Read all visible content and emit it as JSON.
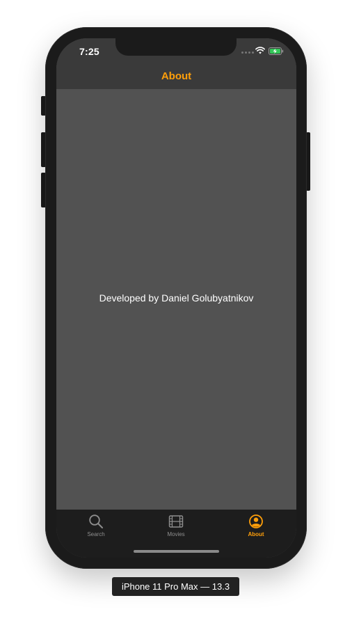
{
  "status_bar": {
    "time": "7:25"
  },
  "nav_bar": {
    "title": "About"
  },
  "content": {
    "credit_text": "Developed by Daniel Golubyatnikov"
  },
  "tab_bar": {
    "items": [
      {
        "label": "Search",
        "icon": "search-icon",
        "selected": false
      },
      {
        "label": "Movies",
        "icon": "film-icon",
        "selected": false
      },
      {
        "label": "About",
        "icon": "person-circle-icon",
        "selected": true
      }
    ]
  },
  "device_label": "iPhone 11 Pro Max — 13.3",
  "colors": {
    "accent": "#ff9f0a",
    "content_bg": "#525252",
    "bar_bg": "#3a3a3a",
    "tab_bar_bg": "#1d1d1d",
    "inactive_tab": "#8e8e8e"
  }
}
